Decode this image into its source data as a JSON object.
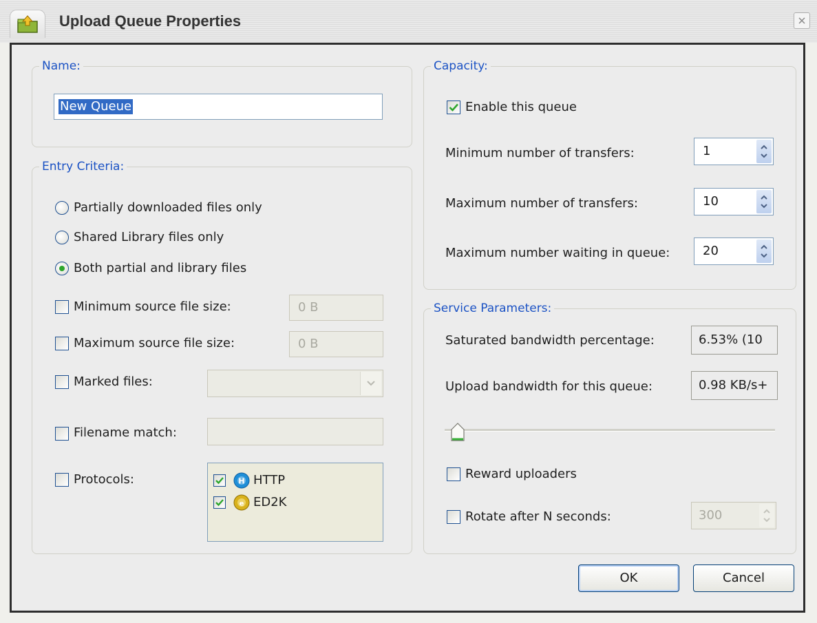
{
  "window": {
    "title": "Upload Queue Properties"
  },
  "name_group": {
    "legend": "Name:",
    "value": "New Queue"
  },
  "entry": {
    "legend": "Entry Criteria:",
    "radios": [
      {
        "label": "Partially downloaded files only",
        "selected": false
      },
      {
        "label": "Shared Library files only",
        "selected": false
      },
      {
        "label": "Both partial and library files",
        "selected": true
      }
    ],
    "min_size": {
      "label": "Minimum source file size:",
      "checked": false,
      "value": "0 B"
    },
    "max_size": {
      "label": "Maximum source file size:",
      "checked": false,
      "value": "0 B"
    },
    "marked": {
      "label": "Marked files:",
      "checked": false,
      "value": ""
    },
    "filename": {
      "label": "Filename match:",
      "checked": false,
      "value": ""
    },
    "protocols": {
      "label": "Protocols:",
      "checked": false,
      "items": [
        {
          "label": "HTTP",
          "checked": true,
          "icon": "http-protocol-icon"
        },
        {
          "label": "ED2K",
          "checked": true,
          "icon": "ed2k-protocol-icon"
        }
      ]
    }
  },
  "capacity": {
    "legend": "Capacity:",
    "enable": {
      "label": "Enable this queue",
      "checked": true
    },
    "min_transfers": {
      "label": "Minimum number of transfers:",
      "value": "1"
    },
    "max_transfers": {
      "label": "Maximum number of transfers:",
      "value": "10"
    },
    "max_waiting": {
      "label": "Maximum number waiting in queue:",
      "value": "20"
    }
  },
  "service": {
    "legend": "Service Parameters:",
    "saturated": {
      "label": "Saturated bandwidth percentage:",
      "value": "6.53% (10"
    },
    "upload": {
      "label": "Upload bandwidth for this queue:",
      "value": "0.98 KB/s+"
    },
    "slider_fraction": 0.02,
    "reward": {
      "label": "Reward uploaders",
      "checked": false
    },
    "rotate": {
      "label": "Rotate after N seconds:",
      "checked": false,
      "value": "300"
    }
  },
  "buttons": {
    "ok": "OK",
    "cancel": "Cancel"
  },
  "colors": {
    "accent_check": "#2da62d",
    "legend_blue": "#1b52c4",
    "frame_border": "#2d2d2d"
  }
}
